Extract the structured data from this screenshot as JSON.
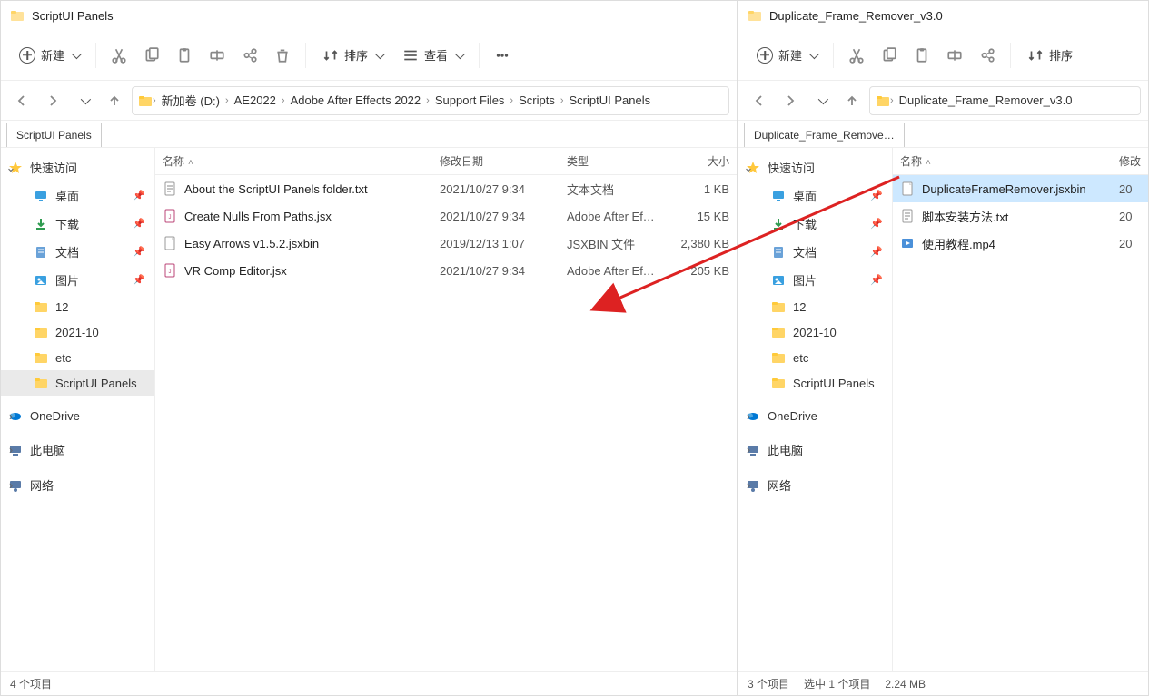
{
  "left": {
    "title": "ScriptUI Panels",
    "toolbar": {
      "new": "新建",
      "sort": "排序",
      "view": "查看"
    },
    "breadcrumb": [
      "新加卷 (D:)",
      "AE2022",
      "Adobe After Effects 2022",
      "Support Files",
      "Scripts",
      "ScriptUI Panels"
    ],
    "tab": "ScriptUI Panels",
    "sidebar": {
      "quick": "快速访问",
      "items": [
        {
          "label": "桌面",
          "icon": "desktop",
          "pin": true
        },
        {
          "label": "下载",
          "icon": "download",
          "pin": true
        },
        {
          "label": "文档",
          "icon": "document",
          "pin": true
        },
        {
          "label": "图片",
          "icon": "picture",
          "pin": true
        },
        {
          "label": "12",
          "icon": "folder"
        },
        {
          "label": "2021-10",
          "icon": "folder"
        },
        {
          "label": "etc",
          "icon": "folder"
        },
        {
          "label": "ScriptUI Panels",
          "icon": "folder",
          "selected": true
        }
      ],
      "onedrive": "OneDrive",
      "thispc": "此电脑",
      "network": "网络"
    },
    "columns": {
      "name": "名称",
      "date": "修改日期",
      "type": "类型",
      "size": "大小"
    },
    "files": [
      {
        "name": "About the ScriptUI Panels folder.txt",
        "date": "2021/10/27 9:34",
        "type": "文本文档",
        "size": "1 KB",
        "icon": "txt"
      },
      {
        "name": "Create Nulls From Paths.jsx",
        "date": "2021/10/27 9:34",
        "type": "Adobe After Effe...",
        "size": "15 KB",
        "icon": "jsx"
      },
      {
        "name": "Easy Arrows v1.5.2.jsxbin",
        "date": "2019/12/13 1:07",
        "type": "JSXBIN 文件",
        "size": "2,380 KB",
        "icon": "file"
      },
      {
        "name": "VR Comp Editor.jsx",
        "date": "2021/10/27 9:34",
        "type": "Adobe After Effe...",
        "size": "205 KB",
        "icon": "jsx"
      }
    ],
    "status": "4 个项目"
  },
  "right": {
    "title": "Duplicate_Frame_Remover_v3.0",
    "toolbar": {
      "new": "新建",
      "sort": "排序"
    },
    "breadcrumb": [
      "Duplicate_Frame_Remover_v3.0"
    ],
    "tab": "Duplicate_Frame_Remove…",
    "sidebar": {
      "quick": "快速访问",
      "items": [
        {
          "label": "桌面",
          "icon": "desktop",
          "pin": true
        },
        {
          "label": "下载",
          "icon": "download",
          "pin": true
        },
        {
          "label": "文档",
          "icon": "document",
          "pin": true
        },
        {
          "label": "图片",
          "icon": "picture",
          "pin": true
        },
        {
          "label": "12",
          "icon": "folder"
        },
        {
          "label": "2021-10",
          "icon": "folder"
        },
        {
          "label": "etc",
          "icon": "folder"
        },
        {
          "label": "ScriptUI Panels",
          "icon": "folder"
        }
      ],
      "onedrive": "OneDrive",
      "thispc": "此电脑",
      "network": "网络"
    },
    "columns": {
      "name": "名称",
      "date": "修改"
    },
    "files": [
      {
        "name": "DuplicateFrameRemover.jsxbin",
        "date": "20",
        "icon": "file",
        "selected": true
      },
      {
        "name": "脚本安装方法.txt",
        "date": "20",
        "icon": "txt"
      },
      {
        "name": "使用教程.mp4",
        "date": "20",
        "icon": "video"
      }
    ],
    "status_items": "3 个项目",
    "status_sel": "选中 1 个项目",
    "status_size": "2.24 MB"
  }
}
